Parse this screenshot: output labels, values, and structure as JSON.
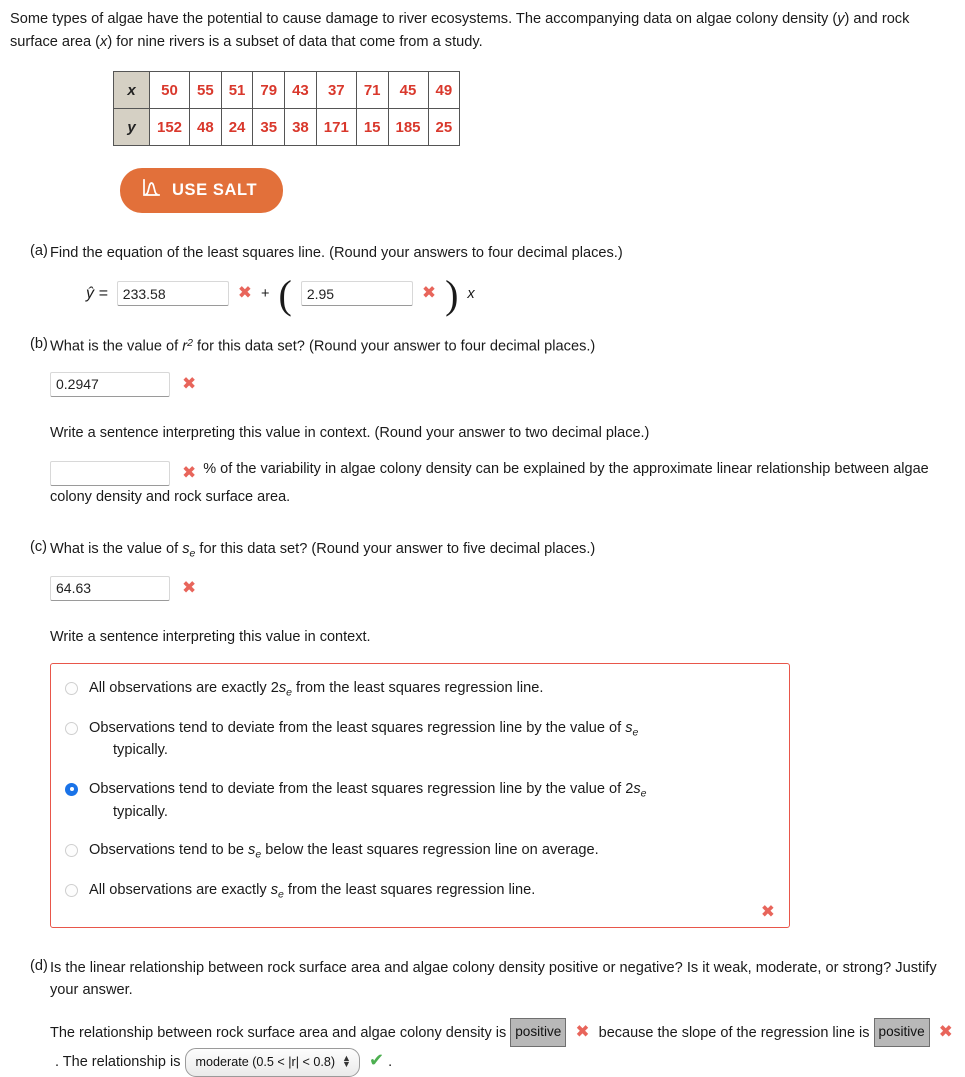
{
  "intro": {
    "line1_a": "Some types of algae have the potential to cause damage to river ecosystems. The accompanying data on algae colony",
    "line2_a": "density (",
    "line2_y": "y",
    "line2_b": ") and rock surface area (",
    "line2_x": "x",
    "line2_c": ") for nine rivers is a subset of data that come from a study."
  },
  "data_table": {
    "row_x_label": "x",
    "row_y_label": "y",
    "x_values": [
      50,
      55,
      51,
      79,
      43,
      37,
      71,
      45,
      49
    ],
    "y_values": [
      152,
      48,
      24,
      35,
      38,
      171,
      15,
      185,
      25
    ]
  },
  "salt_button": {
    "label": "USE SALT",
    "icon": "distribution-curve-icon",
    "background_color": "#e2703a",
    "text_color": "#ffffff"
  },
  "marks": {
    "incorrect": "✖",
    "correct": "✔",
    "incorrect_color": "#e8655b",
    "correct_color": "#4caf50"
  },
  "part_a": {
    "letter": "(a)",
    "question": "Find the equation of the least squares line. (Round your answers to four decimal places.)",
    "yhat_label": "ŷ  =",
    "intercept_value": "233.58",
    "plus": "+",
    "open_paren": "(",
    "slope_value": "2.95",
    "close_paren": ")",
    "x_var": "x"
  },
  "part_b": {
    "letter": "(b)",
    "question_pre": "What is the value of ",
    "question_var": "r",
    "question_sup": "2",
    "question_post": " for this data set? (Round your answer to four decimal places.)",
    "r2_value": "0.2947",
    "interpret_prompt": "Write a sentence interpreting this value in context. (Round your answer to two decimal place.)",
    "percent_value": "",
    "sentence_part1": "% of the variability in algae colony density can be explained by the approximate linear relationship",
    "sentence_part2": "between algae colony density and rock surface area."
  },
  "part_c": {
    "letter": "(c)",
    "question_pre": "What is the value of ",
    "question_var": "s",
    "question_sub": "e",
    "question_post": " for this data set? (Round your answer to five decimal places.)",
    "se_value": "64.63",
    "interpret_prompt": "Write a sentence interpreting this value in context.",
    "options": [
      {
        "selected": false,
        "pre": "All observations are exactly 2",
        "var": "s",
        "sub": "e",
        "post": " from the least squares regression line.",
        "second_line": ""
      },
      {
        "selected": false,
        "pre": "Observations tend to deviate from the least squares regression line by the value of ",
        "var": "s",
        "sub": "e",
        "post": "",
        "second_line": "typically."
      },
      {
        "selected": true,
        "pre": "Observations tend to deviate from the least squares regression line by the value of 2",
        "var": "s",
        "sub": "e",
        "post": "",
        "second_line": "typically."
      },
      {
        "selected": false,
        "pre": "Observations tend to be ",
        "var": "s",
        "sub": "e",
        "post": " below the least squares regression line on average.",
        "second_line": ""
      },
      {
        "selected": false,
        "pre": "All observations are exactly ",
        "var": "s",
        "sub": "e",
        "post": " from the least squares regression line.",
        "second_line": ""
      }
    ],
    "options_box_border_color": "#e8564a"
  },
  "part_d": {
    "letter": "(d)",
    "question_line1": "Is the linear relationship between rock surface area and algae colony density positive or negative? Is it weak,",
    "question_line2": "moderate, or strong? Justify your answer.",
    "sentence_1": "The relationship between rock surface area and algae colony density is",
    "select_1_value": "positive",
    "sentence_2": "because the slope of the",
    "sentence_3": "regression line is",
    "select_2_value": "positive",
    "sentence_4": ". The relationship is",
    "select_3_value": "moderate (0.5 < |r| < 0.8)",
    "sentence_5": "."
  }
}
